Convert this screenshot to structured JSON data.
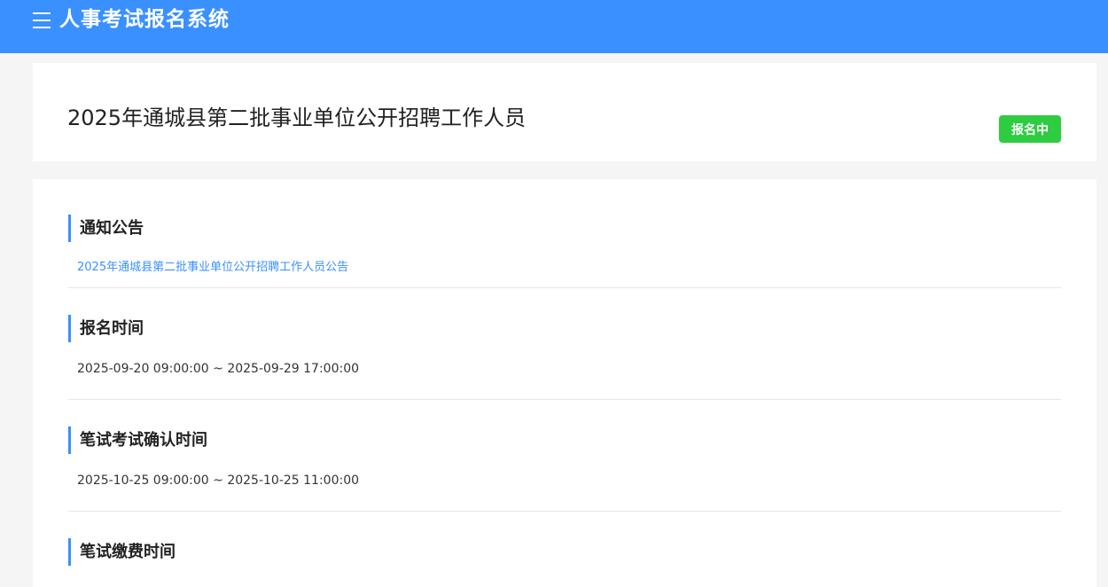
{
  "header": {
    "menu_icon": "hamburger-menu-icon",
    "app_title": "人事考试报名系统",
    "background_color": "#3a90ff"
  },
  "exam": {
    "title": "2025年通城县第二批事业单位公开招聘工作人员",
    "status": "报名中",
    "status_color": "#2ecc40"
  },
  "sections": {
    "notice": {
      "heading": "通知公告",
      "link_text": "2025年通城县第二批事业单位公开招聘工作人员公告"
    },
    "registration": {
      "heading": "报名时间",
      "value": "2025-09-20 09:00:00 ~ 2025-09-29 17:00:00"
    },
    "written_confirm": {
      "heading": "笔试考试确认时间",
      "value": "2025-10-25 09:00:00 ~ 2025-10-25 11:00:00"
    },
    "written_payment": {
      "heading": "笔试缴费时间"
    }
  }
}
